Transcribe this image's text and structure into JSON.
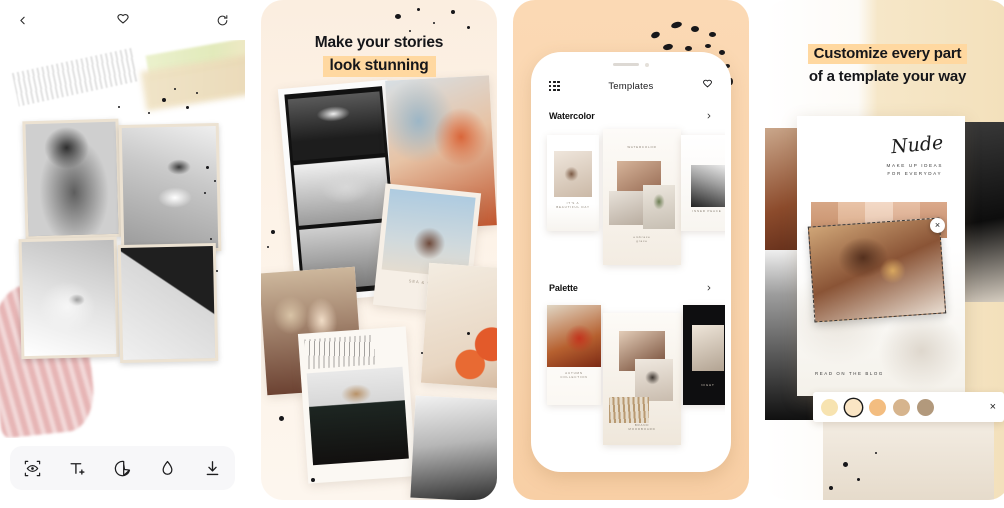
{
  "gallery": {
    "panel_count": 4
  },
  "panel1": {
    "name": "editor-screen",
    "topbar": {
      "back_icon": "chevron-left-icon",
      "favorite_icon": "heart-icon",
      "refresh_icon": "refresh-icon"
    },
    "toolbar": [
      {
        "icon": "preview-eye-icon",
        "label": "Preview"
      },
      {
        "icon": "add-text-icon",
        "label": "Text"
      },
      {
        "icon": "sticker-icon",
        "label": "Sticker"
      },
      {
        "icon": "color-drop-icon",
        "label": "Color"
      },
      {
        "icon": "download-icon",
        "label": "Save"
      }
    ]
  },
  "panel2": {
    "name": "headline-collage",
    "headline_line1": "Make your stories",
    "headline_line2": "look stunning",
    "highlight_color": "#ffd8a0",
    "background_color": "#fbeee0"
  },
  "panel3": {
    "name": "templates-browser",
    "background_color": "#fad5ae",
    "phone": {
      "header": {
        "grid_icon": "grid-icon",
        "title": "Templates",
        "favorite_icon": "heart-icon"
      },
      "sections": [
        {
          "title": "Watercolor",
          "chevron": "chevron-right-icon"
        },
        {
          "title": "Palette",
          "chevron": "chevron-right-icon"
        }
      ]
    }
  },
  "panel4": {
    "name": "customize-template",
    "headline_line1": "Customize every part",
    "headline_line2": "of a template your way",
    "highlight_color": "#ffd8a0",
    "story": {
      "script_title": "Nude",
      "subtitle_line1": "MAKE UP IDEAS",
      "subtitle_line2": "FOR EVERYDAY",
      "footer": "READ ON THE BLOG"
    },
    "selection": {
      "remove_icon": "close-x-icon",
      "label": "×"
    },
    "swatch_bar": {
      "close_icon": "close-x-icon",
      "close_label": "×",
      "swatches": [
        {
          "color": "#f7e3b0",
          "selected": false
        },
        {
          "color": "#fae5c4",
          "selected": true
        },
        {
          "color": "#f3bd80",
          "selected": false
        },
        {
          "color": "#d6b48d",
          "selected": false
        },
        {
          "color": "#b2997c",
          "selected": false
        }
      ]
    }
  }
}
